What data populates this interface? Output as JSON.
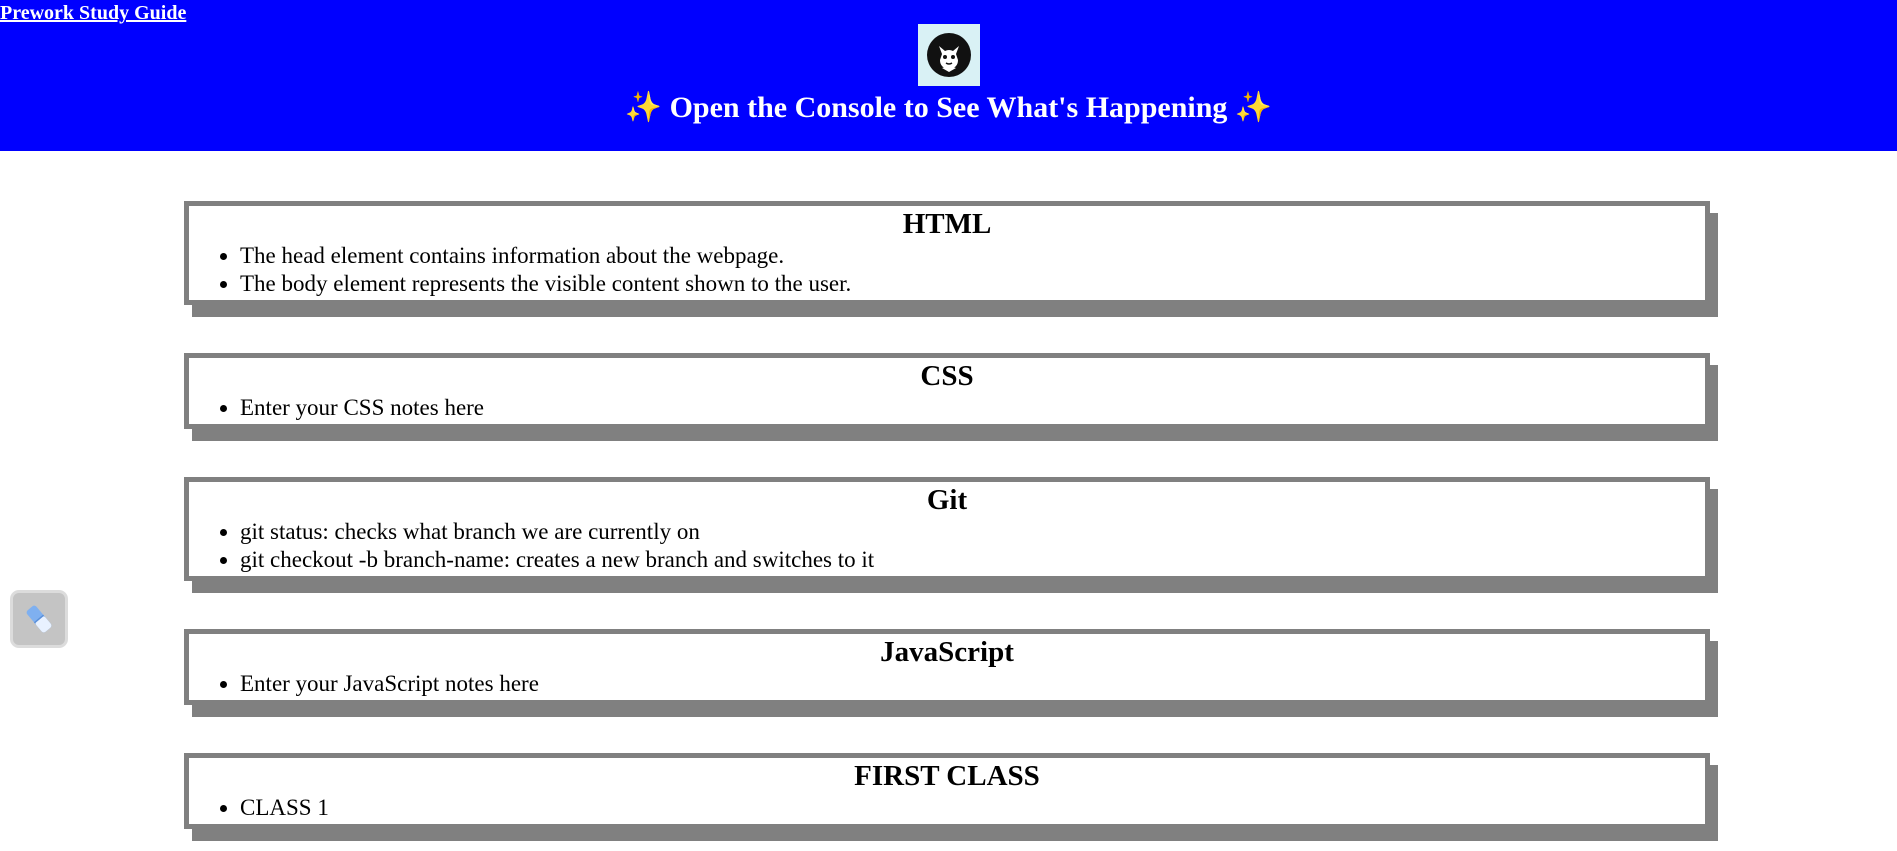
{
  "header": {
    "brand_link": "Prework Study Guide",
    "title": "Open the Console to See What's Happening",
    "title_prefix": "✨",
    "title_suffix": "✨",
    "background_color": "#0000ff",
    "logo_icon": "cat-avatar-icon"
  },
  "sections": [
    {
      "heading": "HTML",
      "items": [
        "The head element contains information about the webpage.",
        "The body element represents the visible content shown to the user."
      ]
    },
    {
      "heading": "CSS",
      "items": [
        "Enter your CSS notes here"
      ]
    },
    {
      "heading": "Git",
      "items": [
        "git status: checks what branch we are currently on",
        "git checkout -b branch-name: creates a new branch and switches to it"
      ]
    },
    {
      "heading": "JavaScript",
      "items": [
        "Enter your JavaScript notes here"
      ]
    },
    {
      "heading": "FIRST CLASS",
      "items": [
        "CLASS 1"
      ]
    }
  ],
  "floating_widget": {
    "icon": "eraser-icon"
  }
}
